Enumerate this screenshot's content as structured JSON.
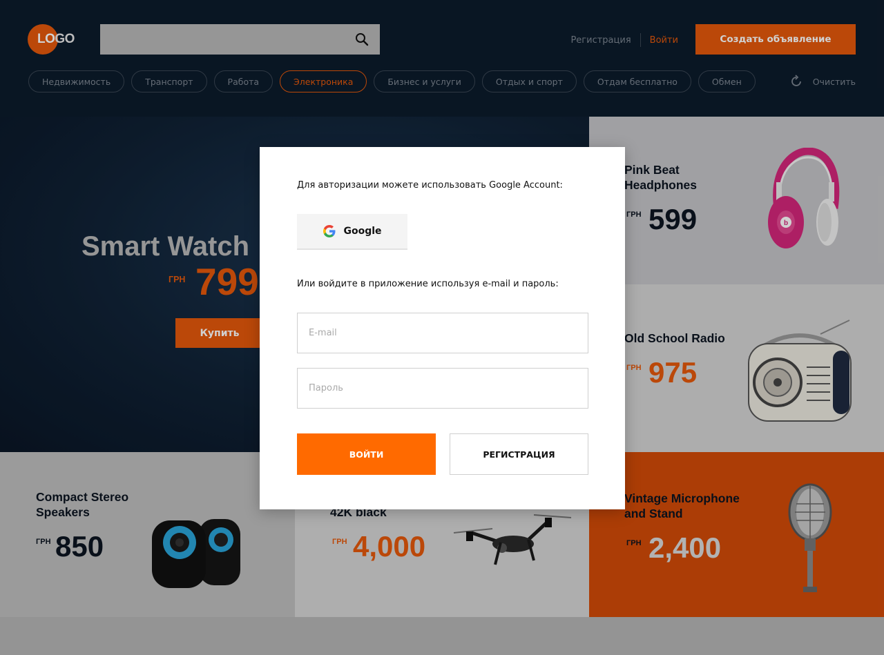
{
  "header": {
    "logo": "LOGO",
    "search": {
      "value": "",
      "placeholder": ""
    },
    "register_link": "Регистрация",
    "login_link": "Войти",
    "create_button": "Создать объявление",
    "categories": [
      {
        "label": "Недвижимость",
        "active": false
      },
      {
        "label": "Транспорт",
        "active": false
      },
      {
        "label": "Работа",
        "active": false
      },
      {
        "label": "Электроника",
        "active": true
      },
      {
        "label": "Бизнес и услуги",
        "active": false
      },
      {
        "label": "Отдых и спорт",
        "active": false
      },
      {
        "label": "Отдам бесплатно",
        "active": false
      },
      {
        "label": "Обмен",
        "active": false
      }
    ],
    "clear_label": "Очистить"
  },
  "hero": {
    "title": "Smart Watch",
    "currency": "ГРН",
    "price": "799",
    "buy_button": "Купить"
  },
  "products": [
    {
      "title_line1": "Pink Beat",
      "title_line2": "Headphones",
      "currency": "ГРН",
      "price": "599"
    },
    {
      "title_line1": "Old School Radio",
      "title_line2": "",
      "currency": "ГРН",
      "price": "975"
    },
    {
      "title_line1": "Compact Stereo",
      "title_line2": "Speakers",
      "currency": "ГРН",
      "price": "850"
    },
    {
      "title_line1": "",
      "title_line2": "42K black",
      "currency": "ГРН",
      "price": "4,000"
    },
    {
      "title_line1": "Vintage Microphone",
      "title_line2": "and Stand",
      "currency": "ГРН",
      "price": "2,400"
    }
  ],
  "modal": {
    "google_prompt": "Для авторизации можете использовать Google Account:",
    "google_button": "Google",
    "email_prompt": "Или войдите в приложение используя e-mail и пароль:",
    "email_placeholder": "E-mail",
    "password_placeholder": "Пароль",
    "login_button": "ВОЙТИ",
    "register_button": "РЕГИСТРАЦИЯ"
  },
  "colors": {
    "accent": "#e4580b",
    "header_bg": "#0c1b2b",
    "login_button": "#ff6a00"
  }
}
